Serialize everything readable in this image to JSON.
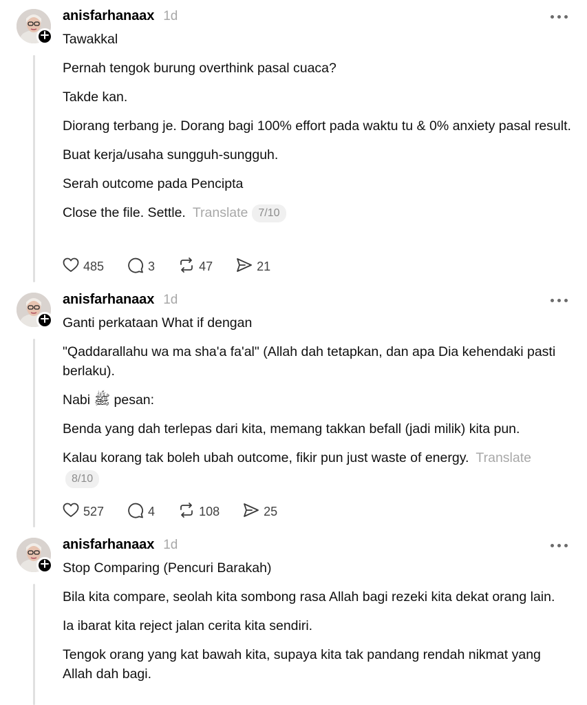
{
  "posts": [
    {
      "username": "anisfarhanaax",
      "time": "1d",
      "paragraphs": [
        "Tawakkal",
        "Pernah tengok burung overthink pasal cuaca?",
        "Takde kan.",
        "Diorang terbang je. Dorang bagi 100% effort pada waktu tu & 0% anxiety pasal result.",
        "Buat kerja/usaha sungguh-sungguh.",
        "Serah outcome pada Pencipta",
        "Close the file. Settle."
      ],
      "translate_label": "Translate",
      "page_badge": "7/10",
      "likes": "485",
      "replies": "3",
      "reposts": "47",
      "shares": "21"
    },
    {
      "username": "anisfarhanaax",
      "time": "1d",
      "paragraphs": [
        "Ganti perkataan What if dengan",
        "\"Qaddarallahu wa ma sha'a fa'al\" (Allah dah tetapkan, dan apa Dia kehendaki pasti berlaku).",
        "Nabi ﷺ pesan:",
        "Benda yang dah terlepas dari kita, memang takkan befall (jadi milik) kita pun.",
        "Kalau korang tak boleh ubah outcome, fikir pun just waste of energy."
      ],
      "translate_label": "Translate",
      "page_badge": "8/10",
      "likes": "527",
      "replies": "4",
      "reposts": "108",
      "shares": "25"
    },
    {
      "username": "anisfarhanaax",
      "time": "1d",
      "paragraphs": [
        "Stop Comparing (Pencuri Barakah)",
        "Bila kita compare, seolah kita sombong rasa Allah bagi rezeki kita dekat orang lain.",
        "Ia ibarat kita reject jalan cerita kita sendiri.",
        "Tengok orang yang kat bawah kita, supaya kita tak pandang rendah nikmat yang Allah dah bagi."
      ]
    }
  ],
  "icons": {
    "like": "heart-icon",
    "reply": "comment-icon",
    "repost": "repost-icon",
    "share": "send-icon",
    "more": "more-dots-icon",
    "follow": "plus-icon"
  },
  "colors": {
    "text": "#101010",
    "muted": "#a8a8a8",
    "thread_line": "#e0e0e0",
    "badge_bg": "#f0f0f0"
  }
}
